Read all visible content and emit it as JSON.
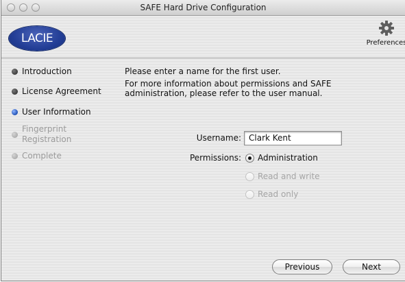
{
  "window": {
    "title": "SAFE Hard Drive Configuration"
  },
  "toolbar": {
    "logo_text": "LACIE",
    "preferences_label": "Preferences",
    "preferences_icon": "gear-icon"
  },
  "steps": [
    {
      "label": "Introduction",
      "state": "done"
    },
    {
      "label": "License Agreement",
      "state": "done"
    },
    {
      "label": "User Information",
      "state": "current"
    },
    {
      "label": "Fingerprint Registration",
      "state": "disabled"
    },
    {
      "label": "Complete",
      "state": "disabled"
    }
  ],
  "main": {
    "intro_line1": "Please enter a name for the first user.",
    "intro_line2": "For more information about permissions and SAFE administration, please refer to the user manual.",
    "username_label": "Username:",
    "username_value": "Clark Kent",
    "permissions_label": "Permissions:",
    "permissions_options": [
      {
        "label": "Administration",
        "selected": true,
        "enabled": true
      },
      {
        "label": "Read and write",
        "selected": false,
        "enabled": false
      },
      {
        "label": "Read only",
        "selected": false,
        "enabled": false
      }
    ]
  },
  "buttons": {
    "previous": "Previous",
    "next": "Next"
  },
  "colors": {
    "accent_blue": "#233e96",
    "current_step_blue": "#1f4fb3"
  }
}
